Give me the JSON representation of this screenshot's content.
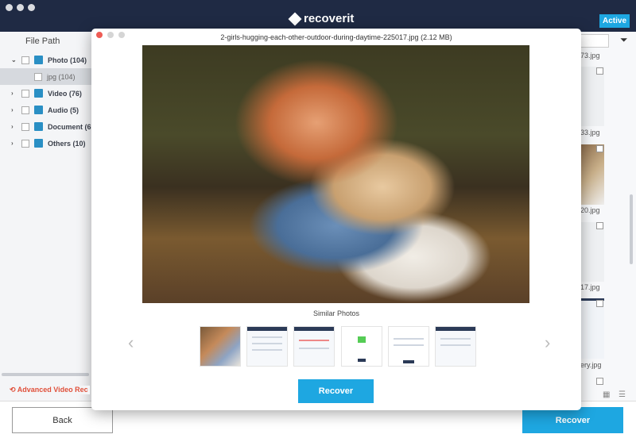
{
  "app": {
    "logo": "recoverit",
    "badge": "Active"
  },
  "sidebar": {
    "header": "File Path",
    "items": [
      {
        "label": "Photo (104)",
        "expanded": true,
        "icon": "photo-icon"
      },
      {
        "label": "jpg (104)",
        "child": true
      },
      {
        "label": "Video (76)",
        "icon": "video-icon"
      },
      {
        "label": "Audio (5)",
        "icon": "audio-icon"
      },
      {
        "label": "Document (6",
        "icon": "document-icon"
      },
      {
        "label": "Others (10)",
        "icon": "others-icon"
      }
    ],
    "advanced": "Advanced Video Rec"
  },
  "files": [
    "73.jpg",
    "33.jpg",
    "20.jpg",
    "17.jpg",
    "ery.jpg"
  ],
  "preview": {
    "title": "2-girls-hugging-each-other-outdoor-during-daytime-225017.jpg (2.12 MB)",
    "similar_label": "Similar Photos",
    "recover": "Recover"
  },
  "footer": {
    "back": "Back",
    "recover": "Recover"
  },
  "colors": {
    "titlebar": "#1f2a44",
    "accent": "#1ea7e1",
    "warning": "#e0503a"
  }
}
